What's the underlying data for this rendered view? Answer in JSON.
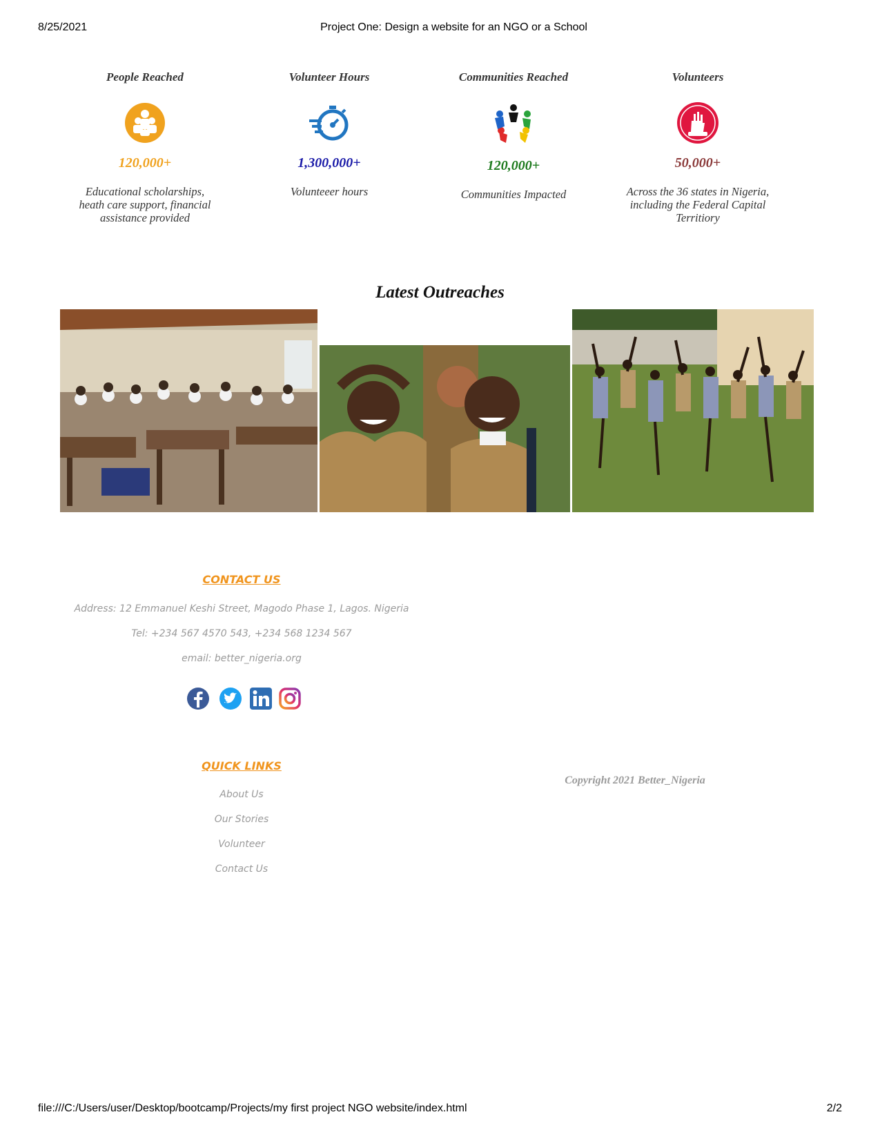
{
  "print_header": {
    "date": "8/25/2021",
    "title": "Project One: Design a website for an NGO or a School"
  },
  "print_footer": {
    "url": "file:///C:/Users/user/Desktop/bootcamp/Projects/my first project NGO website/index.html",
    "page": "2/2"
  },
  "stats": [
    {
      "title": "People Reached",
      "icon": "people-group-icon",
      "value": "120,000+",
      "value_color": "#f0a21e",
      "description": "Educational scholarships, heath care support, financial assistance provided"
    },
    {
      "title": "Volunteer Hours",
      "icon": "stopwatch-icon",
      "value": "1,300,000+",
      "value_color": "#1a1aa8",
      "description": "Volunteeer hours"
    },
    {
      "title": "Communities Reached",
      "icon": "community-circle-icon",
      "value": "120,000+",
      "value_color": "#1d7a1d",
      "description": "Communities Impacted"
    },
    {
      "title": "Volunteers",
      "icon": "volunteer-hands-icon",
      "value": "50,000+",
      "value_color": "#8b3a3a",
      "description": "Across the 36 states in Nigeria, including the Federal Capital Territiory"
    }
  ],
  "outreaches": {
    "heading": "Latest Outreaches",
    "photos": [
      {
        "name": "classroom-photo"
      },
      {
        "name": "smiling-children-photo"
      },
      {
        "name": "children-dancing-photo"
      }
    ]
  },
  "contact": {
    "heading": "CONTACT US",
    "address": "Address: 12 Emmanuel Keshi Street, Magodo Phase 1, Lagos. Nigeria",
    "tel": "Tel: +234 567 4570 543, +234 568 1234 567",
    "email": "email: better_nigeria.org",
    "socials": [
      "facebook-icon",
      "twitter-icon",
      "linkedin-icon",
      "instagram-icon"
    ]
  },
  "quick_links": {
    "heading": "QUICK LINKS",
    "items": [
      "About Us",
      "Our Stories",
      "Volunteer",
      "Contact Us"
    ]
  },
  "copyright": "Copyright 2021 Better_Nigeria",
  "colors": {
    "accent_orange": "#f0941d",
    "muted_text": "#9a9a9a"
  }
}
